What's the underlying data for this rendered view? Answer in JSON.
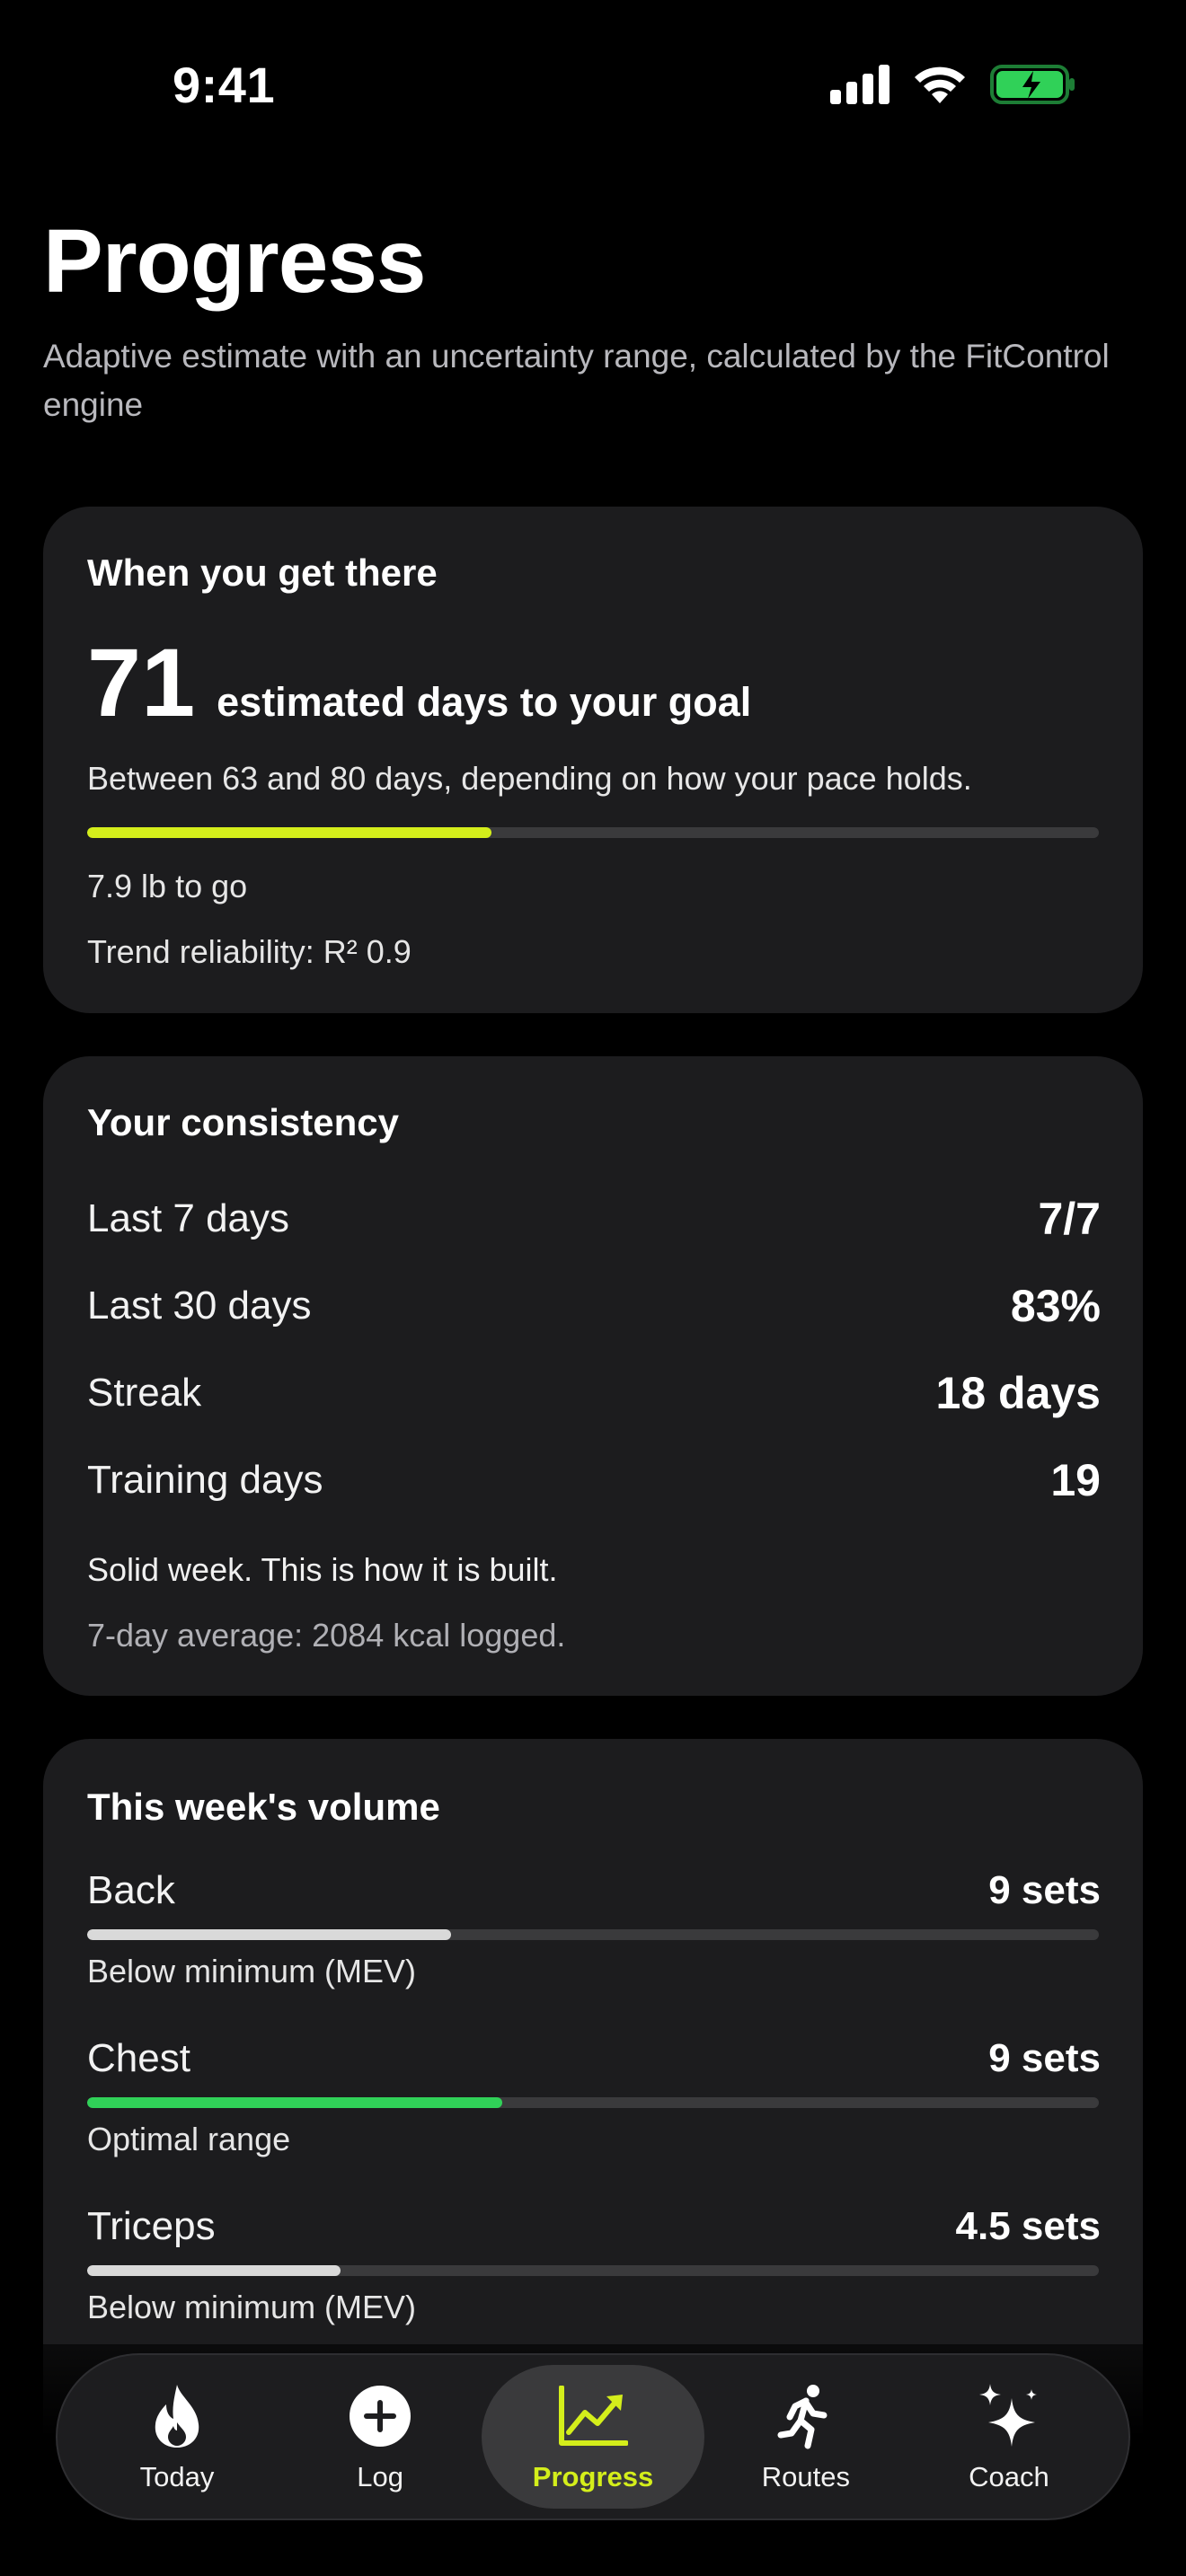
{
  "status_bar": {
    "time": "9:41"
  },
  "header": {
    "title": "Progress",
    "subtitle": "Adaptive estimate with an uncertainty range, calculated by the FitControl engine"
  },
  "goal_card": {
    "title": "When you get there",
    "days": "71",
    "days_caption": "estimated days to your goal",
    "range_text": "Between 63 and 80 days, depending on how your pace holds.",
    "progress_fraction": 0.4,
    "remaining": "7.9 lb to go",
    "reliability": "Trend reliability: R² 0.9"
  },
  "consistency_card": {
    "title": "Your consistency",
    "rows": [
      {
        "label": "Last 7 days",
        "value": "7/7"
      },
      {
        "label": "Last 30 days",
        "value": "83%"
      },
      {
        "label": "Streak",
        "value": "18 days"
      },
      {
        "label": "Training days",
        "value": "19"
      }
    ],
    "message": "Solid week. This is how it is built.",
    "average": "7-day average: 2084 kcal logged."
  },
  "volume_card": {
    "title": "This week's volume",
    "muscles": [
      {
        "name": "Back",
        "value": "9 sets",
        "fraction": 0.36,
        "status": "Below minimum (MEV)",
        "color": "#d9d9d9"
      },
      {
        "name": "Chest",
        "value": "9 sets",
        "fraction": 0.41,
        "status": "Optimal range",
        "color": "#30d158"
      },
      {
        "name": "Triceps",
        "value": "4.5 sets",
        "fraction": 0.25,
        "status": "Below minimum (MEV)",
        "color": "#d9d9d9"
      }
    ]
  },
  "tab_bar": {
    "tabs": [
      {
        "label": "Today",
        "icon": "flame-icon"
      },
      {
        "label": "Log",
        "icon": "plus-circle-icon"
      },
      {
        "label": "Progress",
        "icon": "chart-trend-icon",
        "active": true
      },
      {
        "label": "Routes",
        "icon": "running-figure-icon"
      },
      {
        "label": "Coach",
        "icon": "sparkles-icon"
      }
    ]
  },
  "colors": {
    "accent": "#d4ee1b",
    "card_background": "#1c1c1e",
    "track": "#3a3a3c",
    "optimal": "#30d158",
    "battery": "#30d158"
  }
}
